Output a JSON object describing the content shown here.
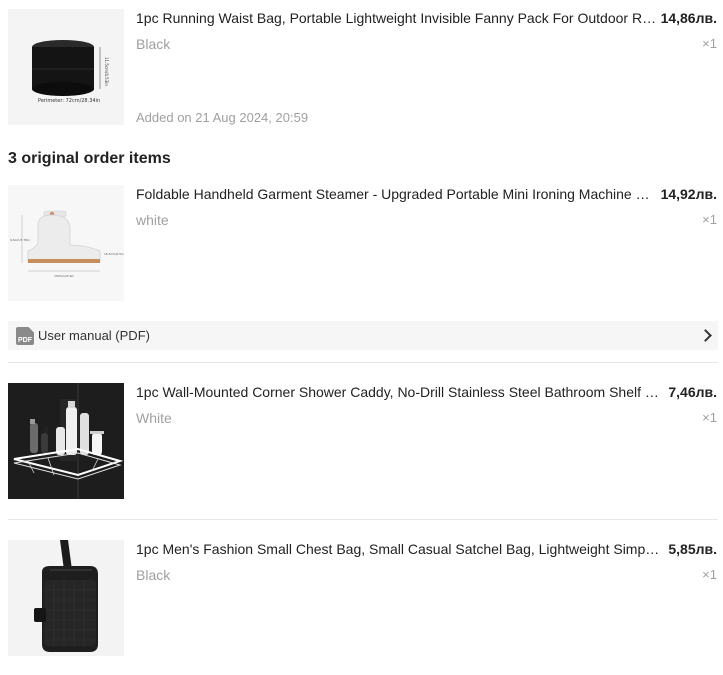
{
  "items": [
    {
      "title": "1pc Running Waist Bag, Portable Lightweight Invisible Fanny Pack For Outdoor Running, Cycling",
      "price": "14,86лв.",
      "variant": "Black",
      "qty": "×1",
      "added": "Added on 21 Aug 2024, 20:59",
      "image_caption": "Perimeter: 72cm/28.34in",
      "image_height_label": "11.5cm/4.53in",
      "icon": "waist-bag"
    }
  ],
  "section_heading": "3 original order items",
  "original_items": [
    {
      "title": "Foldable Handheld Garment Steamer - Upgraded Portable Mini Ironing Machine With Fast Heating",
      "price": "14,92лв.",
      "variant": "white",
      "qty": "×1",
      "image_labels": [
        "9.6cm/3.78in",
        "150mm/5.9in",
        "16.5cm/6.5in"
      ],
      "icon": "garment-steamer",
      "manual": {
        "label": "User manual  (PDF)",
        "icon_text": "PDF"
      }
    },
    {
      "title": "1pc Wall-Mounted Corner Shower Caddy, No-Drill Stainless Steel Bathroom Shelf Organizer",
      "price": "7,46лв.",
      "variant": "White",
      "qty": "×1",
      "icon": "shower-caddy"
    },
    {
      "title": "1pc Men's Fashion Small Chest Bag, Small Casual Satchel Bag, Lightweight Simple Shoulder Bag",
      "price": "5,85лв.",
      "variant": "Black",
      "qty": "×1",
      "icon": "chest-bag"
    }
  ],
  "colors": {
    "muted_text": "#a0a0a0",
    "panel_bg": "#f6f6f6",
    "divider": "#e8e8e8"
  }
}
